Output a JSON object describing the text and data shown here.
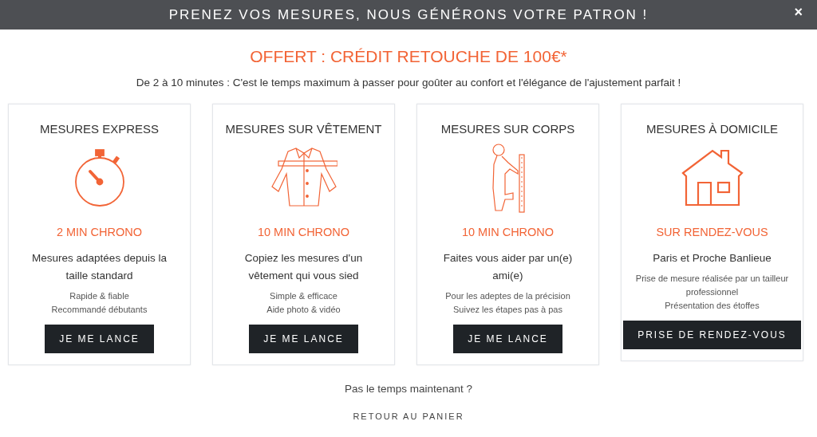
{
  "banner": {
    "title": "PRENEZ VOS MESURES, NOUS GÉNÉRONS VOTRE PATRON !",
    "close": "×"
  },
  "offer": "OFFERT : CRÉDIT RETOUCHE DE 100€*",
  "intro": "De 2 à 10 minutes : C'est le temps maximum à passer pour goûter au confort et l'élégance de l'ajustement parfait !",
  "cards": [
    {
      "title": "MESURES EXPRESS",
      "kind": "stopwatch",
      "duration": "2 MIN CHRONO",
      "description": "Mesures adaptées depuis la taille standard",
      "details": [
        "Rapide & fiable",
        "Recommandé débutants"
      ],
      "button": "JE ME LANCE"
    },
    {
      "title": "MESURES SUR VÊTEMENT",
      "kind": "shirt",
      "duration": "10 MIN CHRONO",
      "description": "Copiez les mesures d'un vêtement qui vous sied",
      "details": [
        "Simple & efficace",
        "Aide photo & vidéo"
      ],
      "button": "JE ME LANCE"
    },
    {
      "title": "MESURES SUR CORPS",
      "kind": "body",
      "duration": "10 MIN CHRONO",
      "description": "Faites vous aider par un(e) ami(e)",
      "details": [
        "Pour les adeptes de la précision",
        "Suivez les étapes pas à pas"
      ],
      "button": "JE ME LANCE"
    },
    {
      "title": "MESURES À DOMICILE",
      "kind": "house",
      "duration": "SUR RENDEZ-VOUS",
      "description": "Paris et Proche Banlieue",
      "details": [
        "Prise de mesure réalisée par un tailleur professionnel",
        "Présentation des étoffes"
      ],
      "button": "PRISE DE RENDEZ-VOUS"
    }
  ],
  "footer": {
    "question": "Pas le temps maintenant ?",
    "link": "RETOUR AU PANIER"
  }
}
